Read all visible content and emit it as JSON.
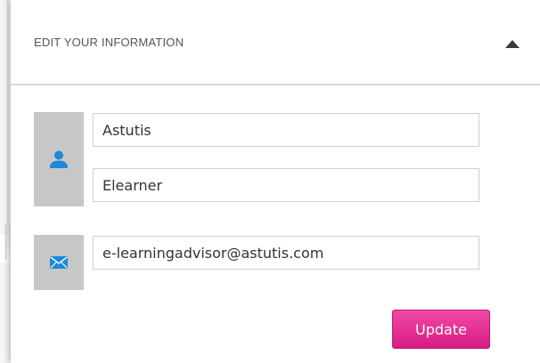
{
  "panel": {
    "title": "EDIT YOUR INFORMATION",
    "collapse_icon": "triangle-up-icon"
  },
  "form": {
    "first_name": "Astutis",
    "last_name": "Elearner",
    "email": "e-learningadvisor@astutis.com",
    "name_icon": "user-icon",
    "email_icon": "envelope-icon",
    "update_label": "Update"
  },
  "colors": {
    "accent": "#e0228b",
    "icon_blue": "#1c8ad6",
    "icon_block_bg": "#c7c7c7"
  }
}
